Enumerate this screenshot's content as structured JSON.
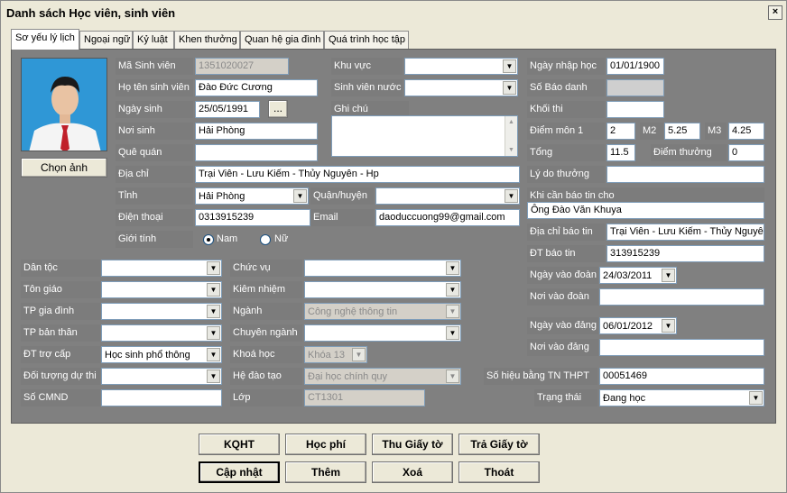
{
  "window": {
    "title": "Danh sách Học viên, sinh viên",
    "close": "×"
  },
  "tabs": [
    "Sơ yếu lý lịch",
    "Ngoại ngữ",
    "Kỷ luật",
    "Khen thưởng",
    "Quan hệ gia đình",
    "Quá trình học tập"
  ],
  "photo": {
    "button": "Chọn ảnh"
  },
  "fields": {
    "ma_sv": {
      "label": "Mã Sinh viên",
      "value": "1351020027"
    },
    "ho_ten": {
      "label": "Họ tên sinh viên",
      "value": "Đào Đức Cương"
    },
    "ngay_sinh": {
      "label": "Ngày sinh",
      "value": "25/05/1991",
      "picker": "..."
    },
    "noi_sinh": {
      "label": "Nơi sinh",
      "value": "Hải Phòng"
    },
    "que_quan": {
      "label": "Quê quán",
      "value": ""
    },
    "dia_chi": {
      "label": "Địa chỉ",
      "value": "Trại Viên - Lưu Kiếm - Thủy Nguyên - Hp"
    },
    "tinh": {
      "label": "Tỉnh",
      "value": "Hải Phòng"
    },
    "quan_huyen": {
      "label": "Quận/huyện",
      "value": ""
    },
    "dien_thoai": {
      "label": "Điện thoại",
      "value": "0313915239"
    },
    "email": {
      "label": "Email",
      "value": "daoduccuong99@gmail.com"
    },
    "gioi_tinh": {
      "label": "Giới tính",
      "nam": "Nam",
      "nu": "Nữ"
    },
    "khu_vuc": {
      "label": "Khu vực",
      "value": ""
    },
    "sv_nuoc": {
      "label": "Sinh viên nước",
      "value": ""
    },
    "ghi_chu": {
      "label": "Ghi chú",
      "value": ""
    },
    "ngay_nhap_hoc": {
      "label": "Ngày nhập học",
      "value": "01/01/1900"
    },
    "so_bao_danh": {
      "label": "Số Báo danh",
      "value": ""
    },
    "khoi_thi": {
      "label": "Khối thi",
      "value": ""
    },
    "diem_mon1": {
      "label": "Điểm môn 1",
      "value": "2"
    },
    "m2": {
      "label": "M2",
      "value": "5.25"
    },
    "m3": {
      "label": "M3",
      "value": "4.25"
    },
    "tong": {
      "label": "Tổng",
      "value": "11.5"
    },
    "diem_thuong": {
      "label": "Điểm thưởng",
      "value": "0"
    },
    "ly_do_thuong": {
      "label": "Lý do thưởng",
      "value": ""
    },
    "khi_can_bao_tin": {
      "label": "Khi cần báo tin cho",
      "value": "Ông Đào Văn Khuya"
    },
    "dia_chi_bao_tin": {
      "label": "Địa chỉ báo tin",
      "value": "Trại Viên - Lưu Kiếm - Thủy Nguyên"
    },
    "dt_bao_tin": {
      "label": "ĐT báo tin",
      "value": "313915239"
    },
    "ngay_vao_doan": {
      "label": "Ngày vào đoàn",
      "value": "24/03/2011"
    },
    "noi_vao_doan": {
      "label": "Nơi vào đoàn",
      "value": ""
    },
    "ngay_vao_dang": {
      "label": "Ngày vào đảng",
      "value": "06/01/2012"
    },
    "noi_vao_dang": {
      "label": "Nơi vào đảng",
      "value": ""
    },
    "dan_toc": {
      "label": "Dân tộc",
      "value": ""
    },
    "ton_giao": {
      "label": "Tôn giáo",
      "value": ""
    },
    "tp_gia_dinh": {
      "label": "TP gia đình",
      "value": ""
    },
    "tp_ban_than": {
      "label": "TP bản thân",
      "value": ""
    },
    "dt_tro_cap": {
      "label": "ĐT trợ cấp",
      "value": "Học sinh phổ thông"
    },
    "doi_tuong_du_thi": {
      "label": "Đối tượng dự thi",
      "value": ""
    },
    "so_cmnd": {
      "label": "Số CMND",
      "value": ""
    },
    "chuc_vu": {
      "label": "Chức vụ",
      "value": ""
    },
    "kiem_nhiem": {
      "label": "Kiêm nhiệm",
      "value": ""
    },
    "nganh": {
      "label": "Ngành",
      "value": "Công nghệ thông tin"
    },
    "chuyen_nganh": {
      "label": "Chuyên ngành",
      "value": ""
    },
    "khoa_hoc": {
      "label": "Khoá học",
      "value": "Khóa 13"
    },
    "he_dao_tao": {
      "label": "Hệ đào tạo",
      "value": "Đại học chính quy"
    },
    "lop": {
      "label": "Lớp",
      "value": "CT1301"
    },
    "so_hieu_bang": {
      "label": "Số hiệu bằng TN THPT",
      "value": "00051469"
    },
    "trang_thai": {
      "label": "Trạng thái",
      "value": "Đang học"
    }
  },
  "buttons": {
    "kqht": "KQHT",
    "hoc_phi": "Học phí",
    "thu_giay_to": "Thu Giấy tờ",
    "tra_giay_to": "Trả Giấy tờ",
    "cap_nhat": "Cập nhật",
    "them": "Thêm",
    "xoa": "Xoá",
    "thoat": "Thoát"
  }
}
